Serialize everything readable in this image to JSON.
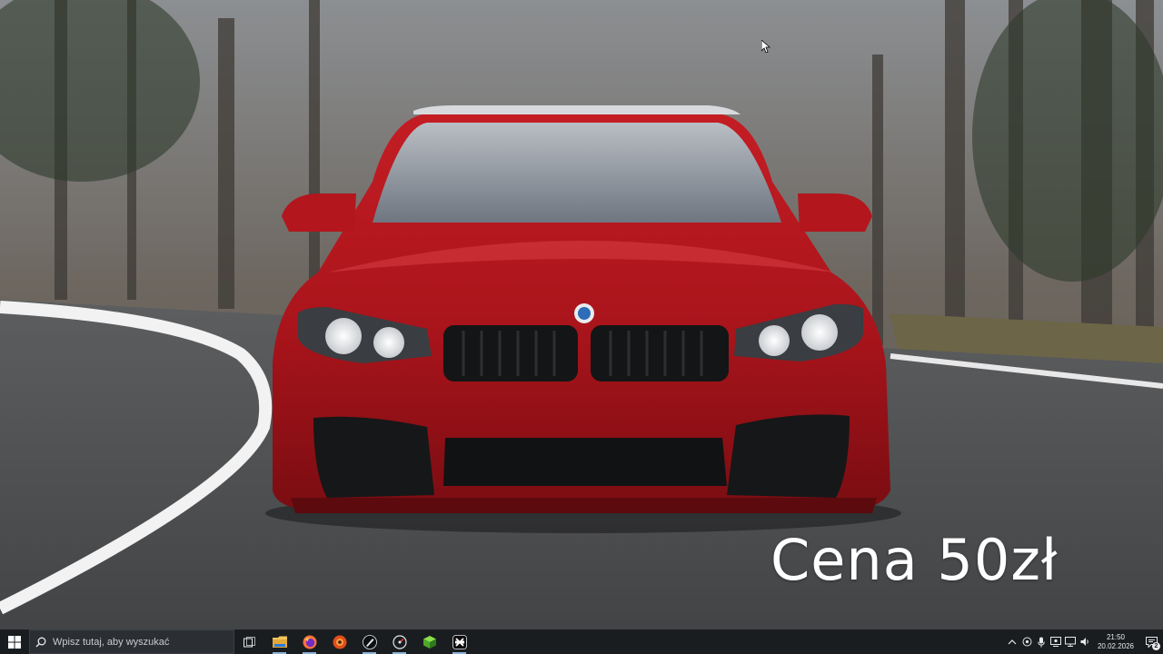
{
  "wallpaper": {
    "price_overlay": "Cena 50zł",
    "car_colors": {
      "body": "#b3161d",
      "body_shadow": "#6e0b10",
      "road": "#4a4c4e",
      "road_line": "#f2f2f2"
    }
  },
  "taskbar": {
    "search": {
      "placeholder": "Wpisz tutaj, aby wyszukać"
    },
    "pinned": [
      {
        "name": "task-view",
        "icon": "task-view-icon"
      },
      {
        "name": "file-explorer",
        "icon": "folder-icon"
      },
      {
        "name": "firefox",
        "icon": "firefox-icon"
      },
      {
        "name": "app-orange",
        "icon": "orange-app-icon"
      },
      {
        "name": "app-dark",
        "icon": "stylus-app-icon"
      },
      {
        "name": "app-speed",
        "icon": "speedometer-icon"
      },
      {
        "name": "app-cube",
        "icon": "green-cube-icon"
      },
      {
        "name": "app-capcut",
        "icon": "capcut-icon"
      }
    ],
    "clock": {
      "time": "21:50",
      "date": "20.02.2026"
    },
    "notifications": {
      "count": "2"
    }
  }
}
